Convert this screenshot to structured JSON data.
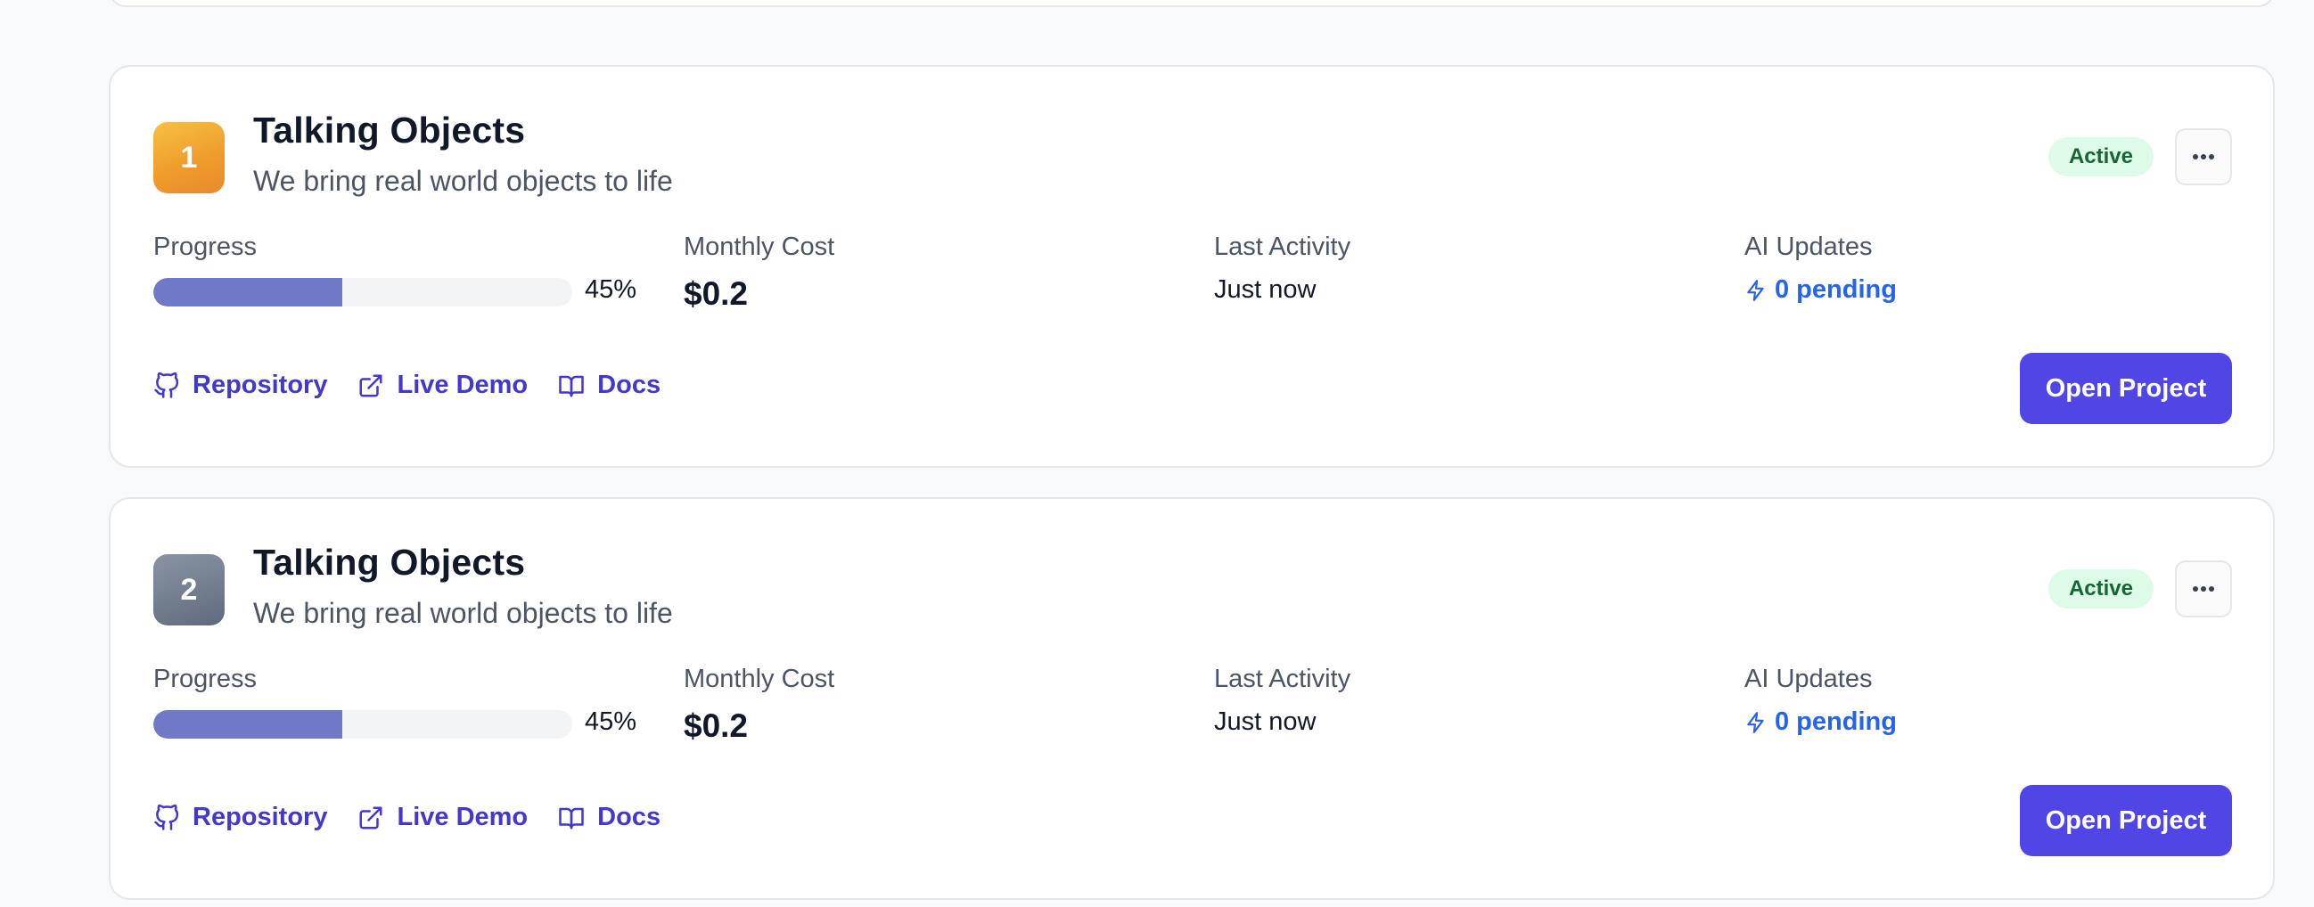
{
  "projects": [
    {
      "number": "1",
      "title": "Talking Objects",
      "description": "We bring real world objects to life",
      "status": "Active",
      "progress_label": "Progress",
      "progress": 0.45,
      "progress_text": "45%",
      "cost_label": "Monthly Cost",
      "cost": "$0.2",
      "activity_label": "Last Activity",
      "activity": "Just now",
      "ai_label": "AI Updates",
      "ai_value": "0 pending",
      "links": {
        "repository": "Repository",
        "live_demo": "Live Demo",
        "docs": "Docs"
      },
      "open_label": "Open Project",
      "icon_color": "orange"
    },
    {
      "number": "2",
      "title": "Talking Objects",
      "description": "We bring real world objects to life",
      "status": "Active",
      "progress_label": "Progress",
      "progress": 0.45,
      "progress_text": "45%",
      "cost_label": "Monthly Cost",
      "cost": "$0.2",
      "activity_label": "Last Activity",
      "activity": "Just now",
      "ai_label": "AI Updates",
      "ai_value": "0 pending",
      "links": {
        "repository": "Repository",
        "live_demo": "Live Demo",
        "docs": "Docs"
      },
      "open_label": "Open Project",
      "icon_color": "gray"
    }
  ],
  "icons": {
    "more": "more-horizontal-icon",
    "ai": "lightning-icon",
    "repository": "github-icon",
    "live_demo": "external-link-icon",
    "docs": "book-open-icon"
  },
  "colors": {
    "accent": "#4f46e5",
    "link": "#4338ca",
    "ai": "#2563eb",
    "active_bg": "#dcfce7",
    "active_text": "#166534",
    "progress_fill": "#7078c8"
  }
}
